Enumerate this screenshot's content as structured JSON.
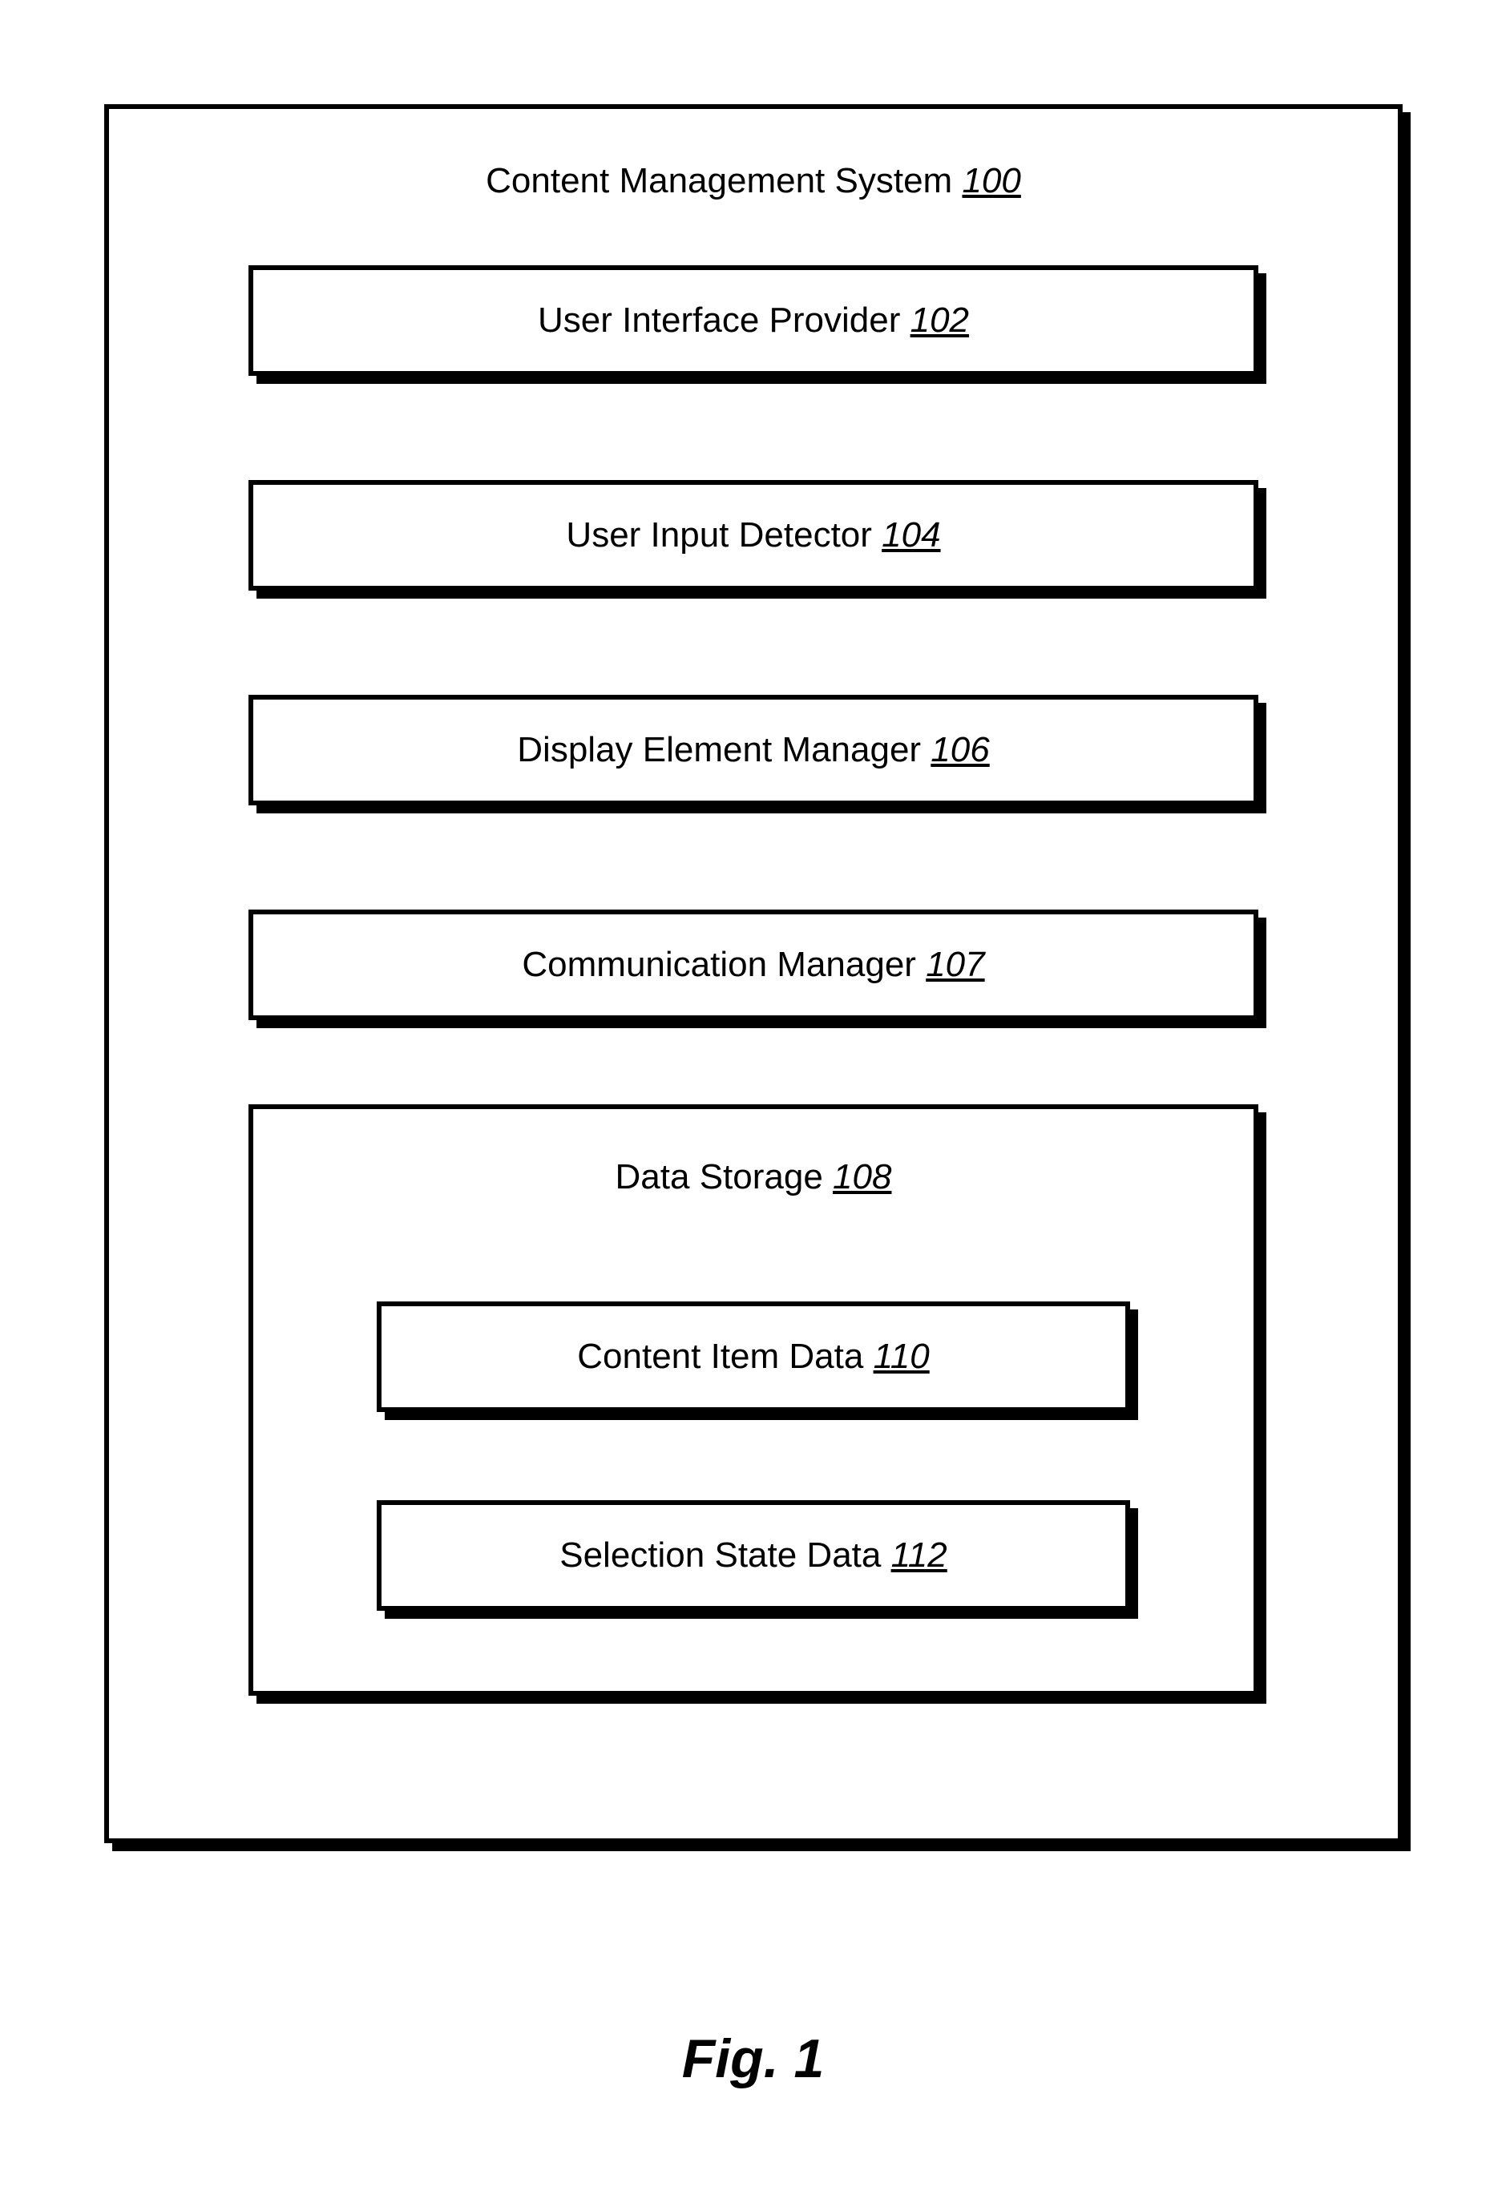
{
  "diagram": {
    "title_text": "Content Management System ",
    "title_ref": "100",
    "boxes": [
      {
        "label": "User Interface Provider ",
        "ref": "102"
      },
      {
        "label": "User Input Detector ",
        "ref": "104"
      },
      {
        "label": "Display Element Manager ",
        "ref": "106"
      },
      {
        "label": "Communication Manager ",
        "ref": "107"
      }
    ],
    "sub_container": {
      "title_text": "Data Storage ",
      "title_ref": "108",
      "boxes": [
        {
          "label": "Content Item Data ",
          "ref": "110"
        },
        {
          "label": "Selection State Data ",
          "ref": "112"
        }
      ]
    }
  },
  "figure_label": "Fig. 1"
}
